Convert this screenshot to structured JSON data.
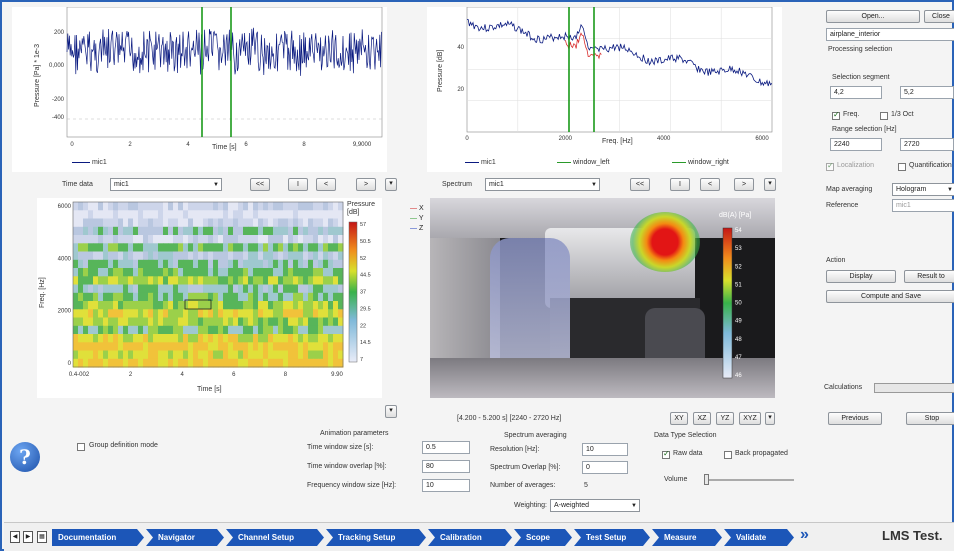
{
  "top_left_chart": {
    "y_label": "Pressure [Pa] * 1e-3",
    "y_ticks": [
      "200",
      "0,000",
      "-200",
      "-400"
    ],
    "x_ticks": [
      "0",
      "2",
      "4",
      "6",
      "8",
      "9,9000"
    ],
    "x_label": "Time [s]",
    "legend": "mic1"
  },
  "top_right_chart": {
    "y_label": "Pressure [dB]",
    "y_ticks": [
      "40",
      "20"
    ],
    "x_ticks": [
      "0",
      "2000",
      "4000",
      "6000"
    ],
    "x_label": "Freq. [Hz]",
    "legend": [
      "mic1",
      "window_left",
      "window_right"
    ]
  },
  "time_data": {
    "label": "Time data",
    "value": "mic1",
    "nav": [
      "<<",
      "I",
      "<",
      ">",
      ">>"
    ]
  },
  "spectrum": {
    "label": "Spectrum",
    "value": "mic1",
    "nav": [
      "<<",
      "I",
      "<",
      ">",
      ">>"
    ]
  },
  "spectrogram": {
    "y_label": "Freq. [Hz]",
    "y_ticks": [
      "6000",
      "4000",
      "2000",
      "0"
    ],
    "x_ticks": [
      "0.4-002",
      "2",
      "4",
      "6",
      "8",
      "9.90"
    ],
    "x_label": "Time [s]",
    "colorbar_title": "Pressure [dB]",
    "colorbar_ticks": [
      "57",
      "50.5",
      "52",
      "44.5",
      "37",
      "29.5",
      "22",
      "14.5",
      "7"
    ]
  },
  "axes_legend": [
    "X",
    "Y",
    "Z"
  ],
  "image": {
    "colorbar_title": "dB(A) [Pa]",
    "colorbar_ticks": [
      "54",
      "53",
      "52",
      "51",
      "50",
      "49",
      "48",
      "47",
      "46"
    ],
    "range_text": "[4.200 - 5.200 s] [2240 - 2720 Hz]",
    "view_buttons": [
      "XY",
      "XZ",
      "YZ",
      "XYZ"
    ]
  },
  "right_panel": {
    "open_label": "Open...",
    "close_label": "Close",
    "file_name": "airplane_interior",
    "processing_selection": "Processing selection",
    "selection_segment": "Selection segment",
    "seg_start": "4,2",
    "seg_end": "5,2",
    "freq_label": "Freq.",
    "oct_label": "1/3 Oct",
    "range_selection": "Range selection [Hz]",
    "range_start": "2240",
    "range_end": "2720",
    "localization": "Localization",
    "quantification": "Quantification",
    "map_averaging_label": "Map averaging",
    "map_averaging_value": "Hologram",
    "reference_label": "Reference",
    "reference_value": "mic1",
    "action_label": "Action",
    "display_label": "Display",
    "result_label": "Result to",
    "compute_label": "Compute and Save",
    "calculations_label": "Calculations",
    "previous_label": "Previous",
    "stop_label": "Stop"
  },
  "bottom": {
    "group_definition": "Group definition mode",
    "animation_title": "Animation parameters",
    "time_window_size_label": "Time window size [s]:",
    "time_window_size": "0.5",
    "time_window_overlap_label": "Time window overlap [%]:",
    "time_window_overlap": "80",
    "freq_window_size_label": "Frequency window size [Hz]:",
    "freq_window_size": "10",
    "spectrum_averaging_title": "Spectrum averaging",
    "resolution_label": "Resolution [Hz]:",
    "resolution": "10",
    "spectrum_overlap_label": "Spectrum Overlap [%]:",
    "spectrum_overlap": "0",
    "num_averages_label": "Number of averages:",
    "num_averages": "5",
    "weighting_label": "Weighting:",
    "weighting_value": "A-weighted",
    "data_type_title": "Data Type Selection",
    "raw_data": "Raw data",
    "back_propagated": "Back propagated",
    "volume_label": "Volume"
  },
  "nav_bar": {
    "items": [
      "Documentation",
      "Navigator",
      "Channel Setup",
      "Tracking Setup",
      "Calibration",
      "Scope",
      "Test Setup",
      "Measure",
      "Validate"
    ],
    "brand": "LMS Test."
  },
  "colors": {
    "accent": "#1c56b8",
    "signal": "#0a1a80"
  }
}
